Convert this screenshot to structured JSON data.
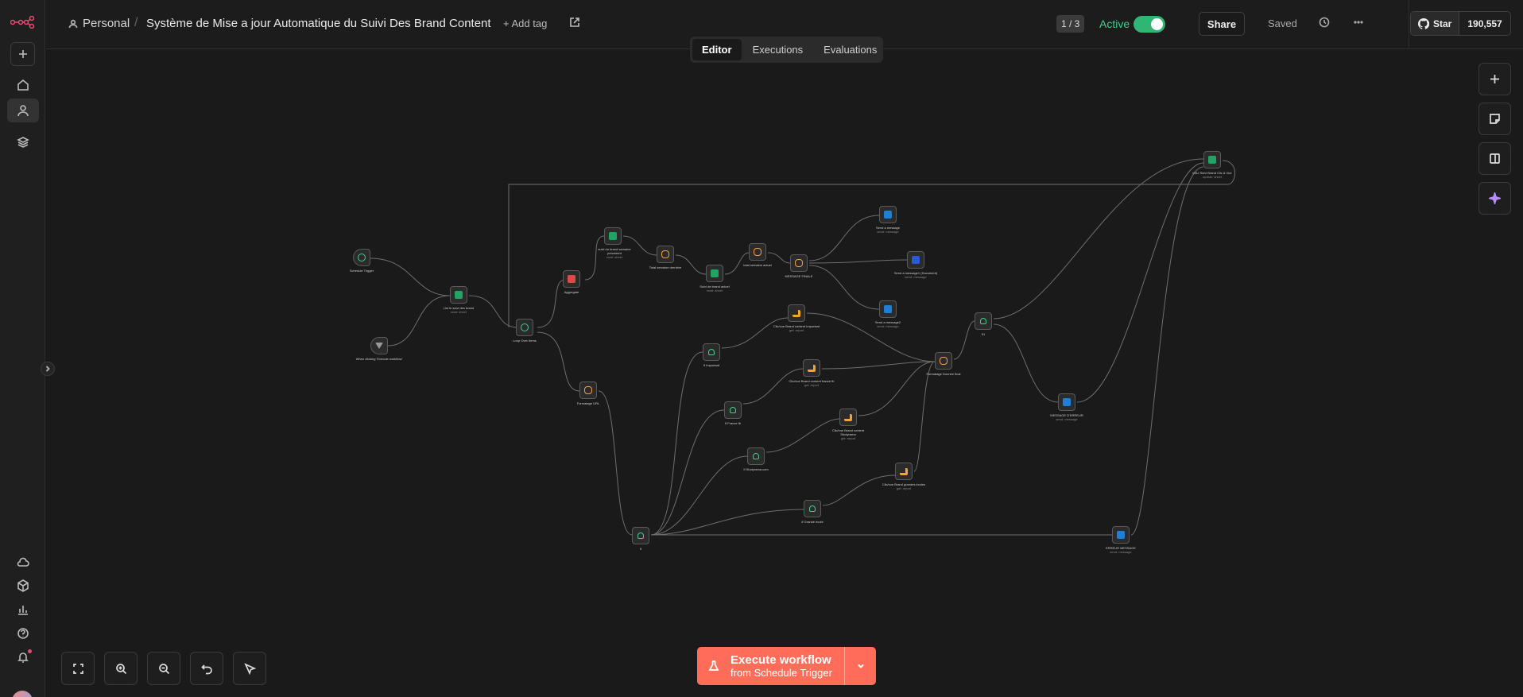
{
  "sidebar": {
    "items": [
      "add-icon",
      "home-icon",
      "user-icon",
      "layers-icon",
      "cloud-icon",
      "cube-icon",
      "stats-icon",
      "help-icon",
      "bell-icon"
    ]
  },
  "header": {
    "project": "Personal",
    "title": "Système de Mise a jour Automatique du Suivi Des Brand Content",
    "add_tag": "+ Add tag",
    "pager": "1 / 3",
    "active_label": "Active",
    "share": "Share",
    "saved": "Saved",
    "github_star": "Star",
    "github_count": "190,557"
  },
  "tabs": [
    "Editor",
    "Executions",
    "Evaluations"
  ],
  "execute": {
    "title": "Execute workflow",
    "subtitle": "from Schedule Trigger"
  },
  "nodes": [
    {
      "label": "Schedule Trigger",
      "sub": ""
    },
    {
      "label": "When clicking 'Execute workflow'",
      "sub": ""
    },
    {
      "label": "List le suivi des brand",
      "sub": "read: sheet"
    },
    {
      "label": "Loop Over Items",
      "sub": ""
    },
    {
      "label": "Aggregate",
      "sub": ""
    },
    {
      "label": "suivi du brand semaine précédent",
      "sub": "read: sheet"
    },
    {
      "label": "Total semaine dernière",
      "sub": ""
    },
    {
      "label": "Suivi de brand actuel",
      "sub": "read: sheet"
    },
    {
      "label": "total semaine actuel",
      "sub": ""
    },
    {
      "label": "MESSAGE FINALE",
      "sub": ""
    },
    {
      "label": "Send a message",
      "sub": "send: message"
    },
    {
      "label": "Send a message1 (Document)",
      "sub": "send: message"
    },
    {
      "label": "Send a message2",
      "sub": "send: message"
    },
    {
      "label": "Formatage URL",
      "sub": ""
    },
    {
      "label": "If",
      "sub": ""
    },
    {
      "label": "If Important",
      "sub": ""
    },
    {
      "label": "Clic/vue Brand content Important",
      "sub": "get: report"
    },
    {
      "label": "If France fb",
      "sub": ""
    },
    {
      "label": "Clic/vue Brand content france fb",
      "sub": "get: report"
    },
    {
      "label": "Clic/vue Brand content Studyrama",
      "sub": "get: report"
    },
    {
      "label": "If Studyrama.com",
      "sub": ""
    },
    {
      "label": "If Grande école",
      "sub": ""
    },
    {
      "label": "Clic/vue Brand grandes écoles",
      "sub": "get: report"
    },
    {
      "label": "Formatage Donnée final",
      "sub": ""
    },
    {
      "label": "If1",
      "sub": ""
    },
    {
      "label": "MESSAGE D'ERREUR",
      "sub": "send: message"
    },
    {
      "label": "ERREUR MESSAGE",
      "sub": "send: message"
    },
    {
      "label": "MAJ Suivi Brand Clic & Vue",
      "sub": "update: sheet"
    }
  ]
}
